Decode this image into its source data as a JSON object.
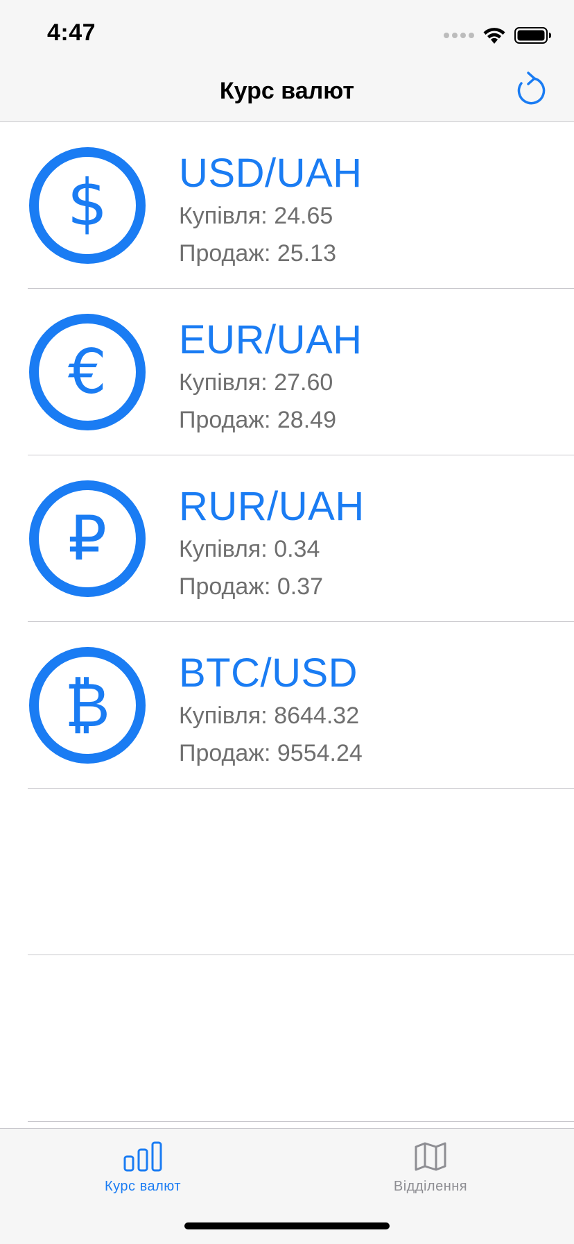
{
  "status_bar": {
    "time": "4:47",
    "icons": [
      "cellular-signal-icon",
      "wifi-icon",
      "battery-icon"
    ]
  },
  "nav": {
    "title": "Курс валют",
    "refresh_icon": "refresh-icon"
  },
  "colors": {
    "accent": "#1a7cf3",
    "secondary_text": "#6f6f6f",
    "tab_inactive": "#8e8e93",
    "bar_background": "#f6f6f6",
    "separator": "#c8c7cc"
  },
  "rates": [
    {
      "icon": "dollar-coin-icon",
      "pair": "USD/UAH",
      "buy": "Купівля: 24.65",
      "sell": "Продаж: 25.13"
    },
    {
      "icon": "euro-coin-icon",
      "pair": "EUR/UAH",
      "buy": "Купівля: 27.60",
      "sell": "Продаж: 28.49"
    },
    {
      "icon": "ruble-coin-icon",
      "pair": "RUR/UAH",
      "buy": "Купівля: 0.34",
      "sell": "Продаж: 0.37"
    },
    {
      "icon": "bitcoin-coin-icon",
      "pair": "BTC/USD",
      "buy": "Купівля: 8644.32",
      "sell": "Продаж: 9554.24"
    }
  ],
  "tab_bar": {
    "tabs": [
      {
        "label": "Курс валют",
        "icon": "bar-chart-icon",
        "selected": true
      },
      {
        "label": "Відділення",
        "icon": "map-icon",
        "selected": false
      }
    ]
  }
}
